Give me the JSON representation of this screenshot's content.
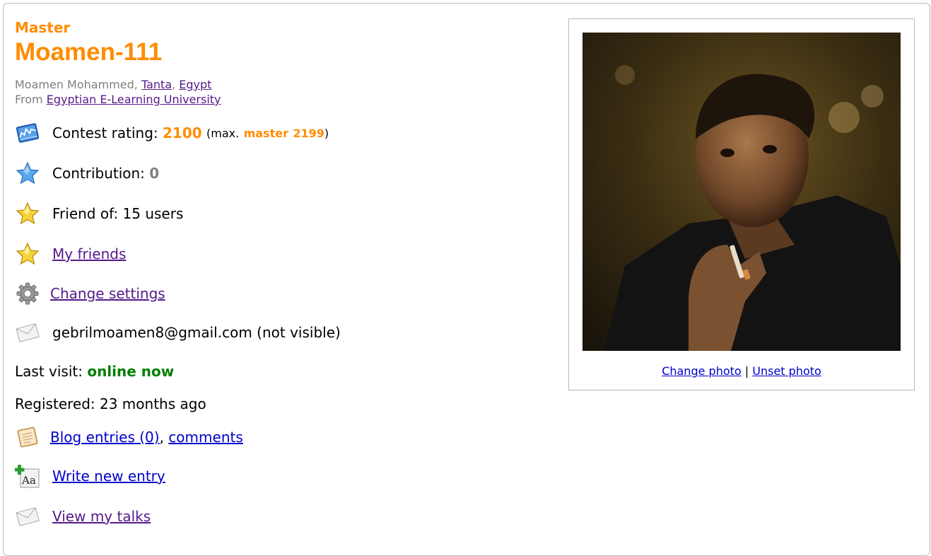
{
  "profile": {
    "rank": "Master",
    "handle": "Moamen-111",
    "name": "Moamen Mohammed",
    "city": "Tanta",
    "country": "Egypt",
    "from_label": "From",
    "organization": "Egyptian E-Learning University"
  },
  "contest_rating": {
    "label": "Contest rating:",
    "value": "2100",
    "max_prefix": "(max.",
    "max_rank": "master",
    "max_value": "2199",
    "max_suffix": ")"
  },
  "contribution": {
    "label": "Contribution:",
    "value": "0"
  },
  "friend_of": {
    "text": "Friend of: 15 users"
  },
  "links": {
    "my_friends": "My friends",
    "change_settings": "Change settings",
    "blog_entries": "Blog entries (0)",
    "comments": "comments",
    "write_new_entry": "Write new entry",
    "view_my_talks": "View my talks"
  },
  "email": {
    "text": "gebrilmoamen8@gmail.com (not visible)"
  },
  "last_visit": {
    "label": "Last visit:",
    "value": "online now"
  },
  "registered": {
    "text": "Registered: 23 months ago"
  },
  "photo": {
    "change_label": "Change photo",
    "separator": "|",
    "unset_label": "Unset photo"
  },
  "colors": {
    "master": "#ff8c00",
    "online": "#008000",
    "link_visited": "#551a8b",
    "link": "#0000cc"
  },
  "icons": [
    "rating-chart-icon",
    "contribution-star-icon",
    "friend-star-icon",
    "friends-star-icon",
    "settings-gear-icon",
    "envelope-icon",
    "blog-notebook-icon",
    "write-entry-icon",
    "talks-envelope-icon"
  ]
}
